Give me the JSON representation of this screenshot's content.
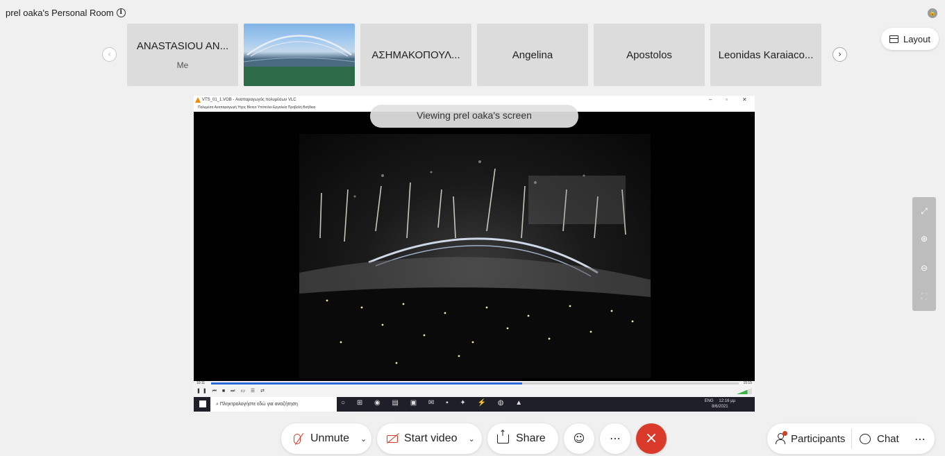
{
  "header": {
    "room_title": "prel oaka's Personal Room",
    "info_icon": "info-icon",
    "lock_icon": "lock-icon"
  },
  "participants_strip": {
    "tiles": [
      {
        "name": "ANASTASIOU AN...",
        "sub": "Me"
      },
      {
        "name": "",
        "video": true
      },
      {
        "name": "ΑΣΗΜΑΚΟΠΟΥΛ..."
      },
      {
        "name": "Angelina"
      },
      {
        "name": "Apostolos"
      },
      {
        "name": "Leonidas Karaiaco..."
      }
    ],
    "prev_icon": "chevron-left-icon",
    "next_icon": "chevron-right-icon"
  },
  "layout_button": {
    "label": "Layout",
    "icon": "layout-icon"
  },
  "shared_screen": {
    "viewing_label": "Viewing prel oaka's screen",
    "vlc_window_title": "VTS_01_1.VOB - Αναπαραγωγός πολυμέσων VLC",
    "vlc_menu": "Πολυμέσα   Αναπαραγωγή   Ήχος   Βίντεο   Υπότιτλοι   Εργαλεία   Προβολή   Βοήθεια",
    "vlc_time_left": "10:11",
    "vlc_time_right": "15:15",
    "progress": 0.59,
    "taskbar_search": "Πληκτρολογήστε εδώ για αναζήτηση",
    "taskbar_lang": "ENG",
    "taskbar_clock": "12:16 μμ",
    "taskbar_date": "8/6/2021"
  },
  "zoom_panel": {
    "buttons": [
      "expand-icon",
      "zoom-in-icon",
      "zoom-out-icon",
      "fit-icon"
    ]
  },
  "toolbar": {
    "unmute_label": "Unmute",
    "start_video_label": "Start video",
    "share_label": "Share",
    "reactions_icon": "smiley-icon",
    "more_icon": "ellipsis-icon",
    "end_icon": "close-icon",
    "participants_label": "Participants",
    "chat_label": "Chat"
  },
  "colors": {
    "end_call": "#d93a2a",
    "muted_icon": "#d63a2a",
    "background": "#f0f0f0"
  }
}
